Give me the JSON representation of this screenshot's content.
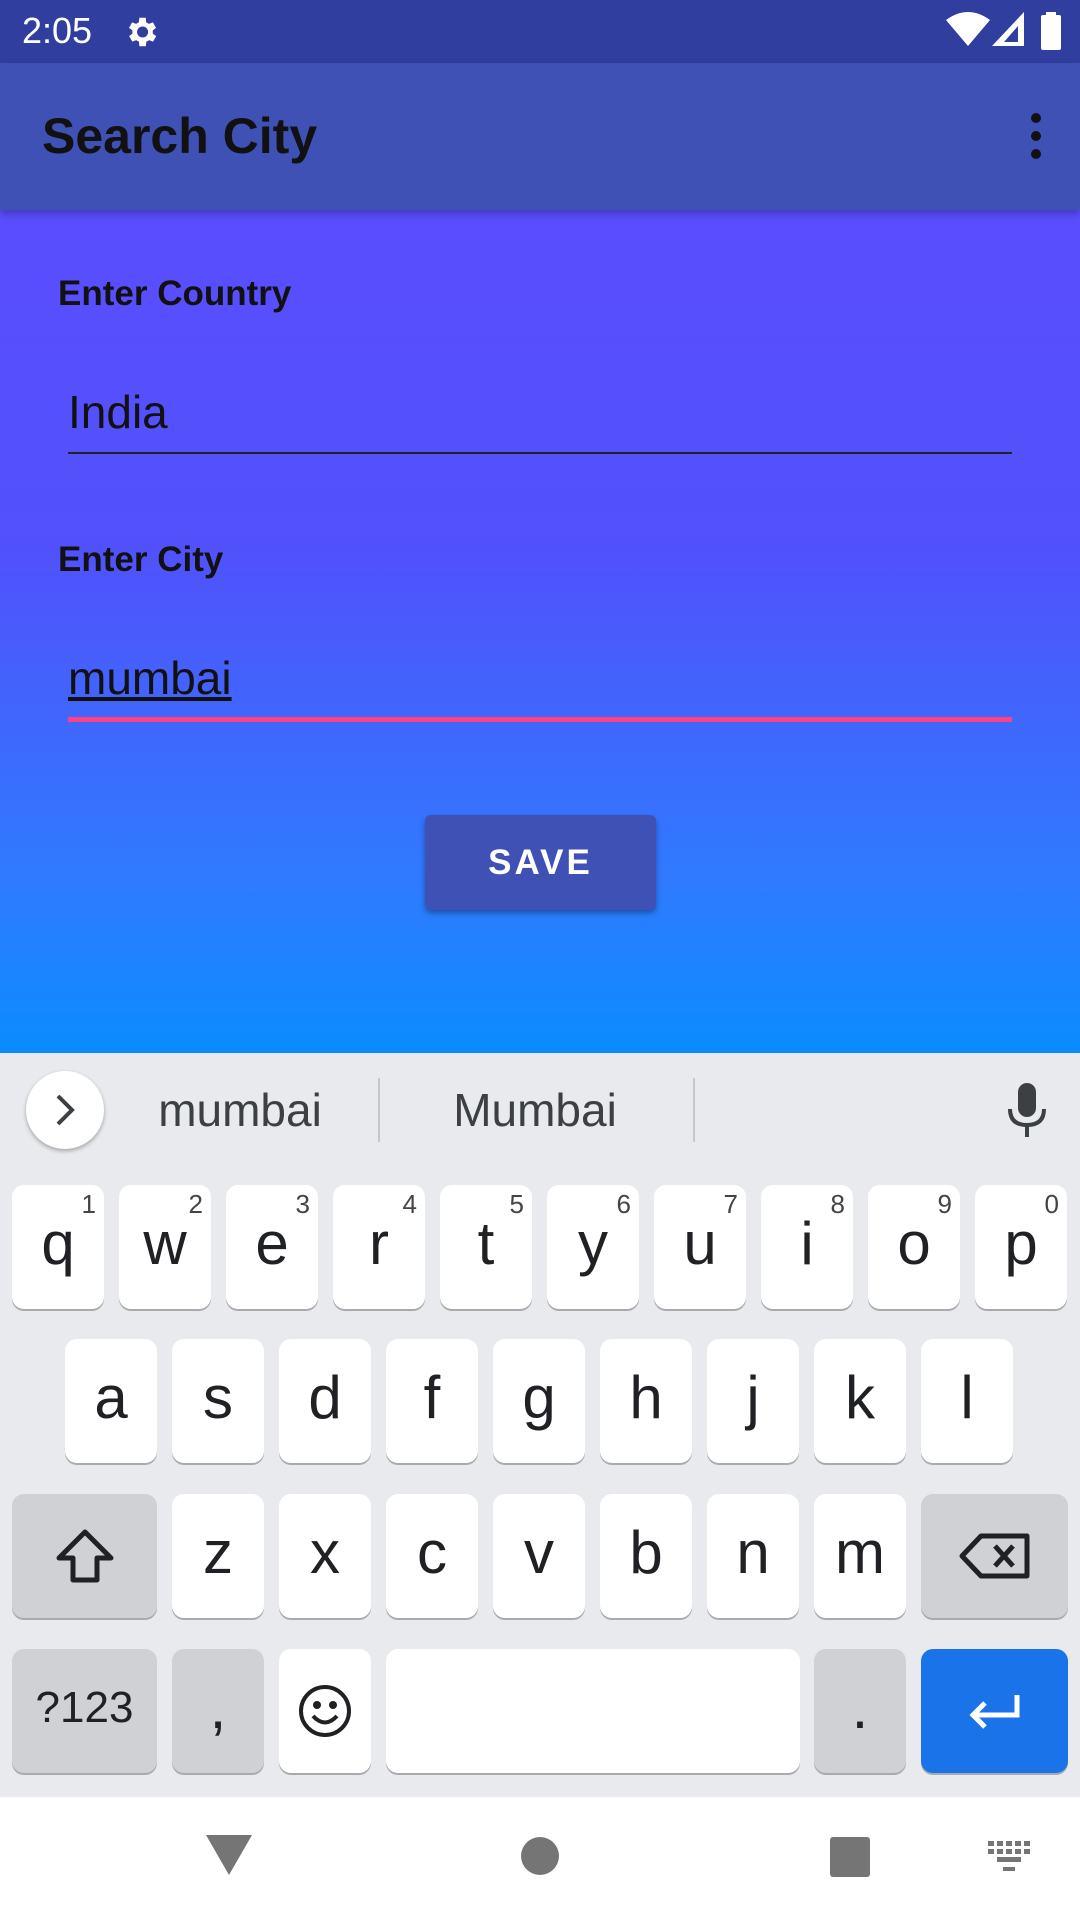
{
  "status_bar": {
    "time": "2:05"
  },
  "app_bar": {
    "title": "Search City"
  },
  "form": {
    "country_label": "Enter Country",
    "country_value": "India",
    "city_label": "Enter City",
    "city_value": "mumbai",
    "save_label": "SAVE"
  },
  "keyboard": {
    "suggestions": [
      "mumbai",
      "Mumbai"
    ],
    "row1": [
      {
        "k": "q",
        "h": "1"
      },
      {
        "k": "w",
        "h": "2"
      },
      {
        "k": "e",
        "h": "3"
      },
      {
        "k": "r",
        "h": "4"
      },
      {
        "k": "t",
        "h": "5"
      },
      {
        "k": "y",
        "h": "6"
      },
      {
        "k": "u",
        "h": "7"
      },
      {
        "k": "i",
        "h": "8"
      },
      {
        "k": "o",
        "h": "9"
      },
      {
        "k": "p",
        "h": "0"
      }
    ],
    "row2": [
      "a",
      "s",
      "d",
      "f",
      "g",
      "h",
      "j",
      "k",
      "l"
    ],
    "row3": [
      "z",
      "x",
      "c",
      "v",
      "b",
      "n",
      "m"
    ],
    "symbols_label": "?123",
    "comma": ",",
    "period": "."
  },
  "colors": {
    "status_bar": "#303f9f",
    "app_bar": "#3f51b5",
    "accent": "#ff4081",
    "enter_key": "#1a73e8"
  }
}
